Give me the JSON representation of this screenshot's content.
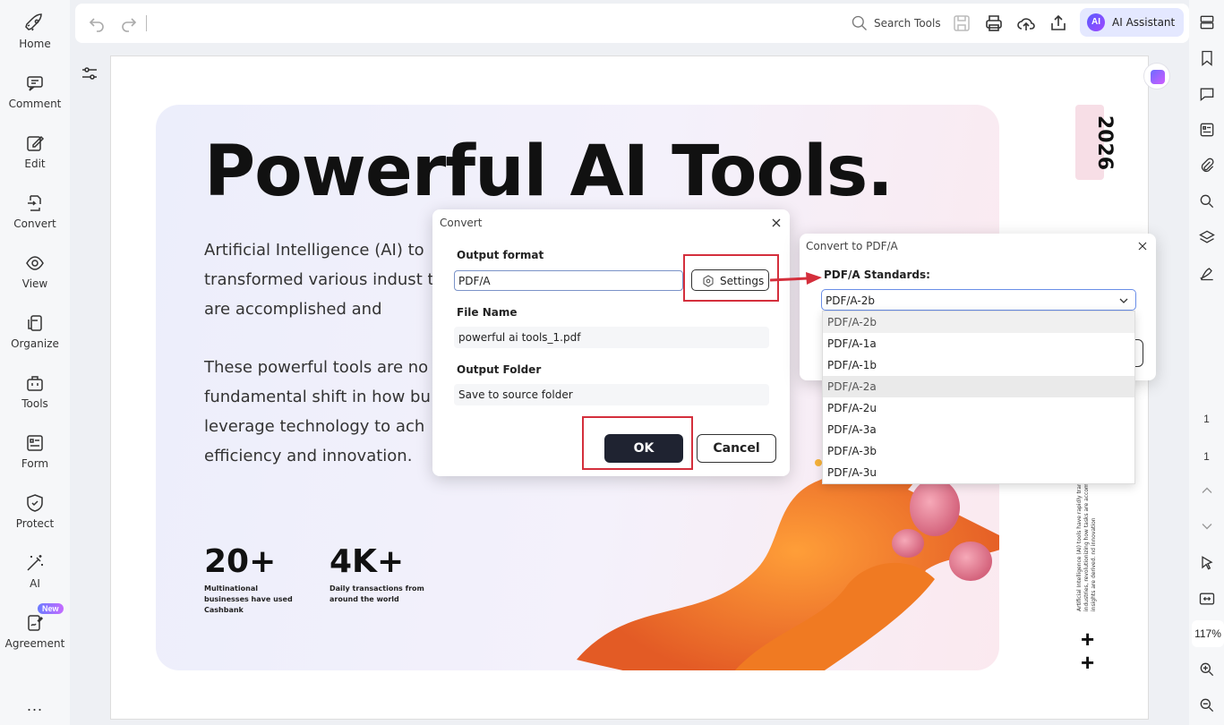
{
  "sidebar": {
    "items": [
      {
        "label": "Home",
        "icon": "rocket-icon"
      },
      {
        "label": "Comment",
        "icon": "comment-icon"
      },
      {
        "label": "Edit",
        "icon": "edit-icon"
      },
      {
        "label": "Convert",
        "icon": "convert-icon"
      },
      {
        "label": "View",
        "icon": "eye-icon"
      },
      {
        "label": "Organize",
        "icon": "organize-icon"
      },
      {
        "label": "Tools",
        "icon": "toolbox-icon"
      },
      {
        "label": "Form",
        "icon": "form-icon"
      },
      {
        "label": "Protect",
        "icon": "shield-icon"
      },
      {
        "label": "AI",
        "icon": "magic-wand-icon"
      },
      {
        "label": "Agreement",
        "icon": "agreement-icon",
        "badge": "New"
      }
    ],
    "more": "..."
  },
  "toolbar": {
    "search_label": "Search Tools",
    "ai_badge": "AI",
    "ai_label": "AI Assistant"
  },
  "document": {
    "headline": "Powerful AI Tools.",
    "paragraph1": "Artificial Intelligence (AI) to transformed various indust tasks are accomplished and",
    "paragraph2": "These powerful tools are no fundamental shift in how bu leverage technology to ach efficiency and innovation.",
    "stat1_value": "20+",
    "stat1_caption": "Multinational businesses have used Cashbank",
    "stat2_value": "4K+",
    "stat2_caption": "Daily transactions from around the world",
    "year": "2026",
    "side_text": "Artificial Intelligence (AI) tools have rapidly trans industries, revolutionizing how tasks are accompl insights are derived. nd innovation",
    "plus_signs": [
      "+",
      "+"
    ]
  },
  "convert_dialog": {
    "title": "Convert",
    "output_format_label": "Output format",
    "output_format_value": "PDF/A",
    "settings_label": "Settings",
    "file_name_label": "File Name",
    "file_name_value": "powerful ai tools_1.pdf",
    "output_folder_label": "Output Folder",
    "output_folder_value": "Save to source folder",
    "ok_label": "OK",
    "cancel_label": "Cancel"
  },
  "pdfa_dialog": {
    "title": "Convert to PDF/A",
    "standards_label": "PDF/A Standards:",
    "selected": "PDF/A-2b",
    "options": [
      "PDF/A-2b",
      "PDF/A-1a",
      "PDF/A-1b",
      "PDF/A-2a",
      "PDF/A-2u",
      "PDF/A-3a",
      "PDF/A-3b",
      "PDF/A-3u"
    ]
  },
  "right_rail": {
    "page_current": "1",
    "page_total": "1",
    "zoom": "117%"
  },
  "colors": {
    "highlight": "#d42f3c",
    "ok_button": "#1f2331",
    "ai_button_bg": "#e4e8ff"
  }
}
